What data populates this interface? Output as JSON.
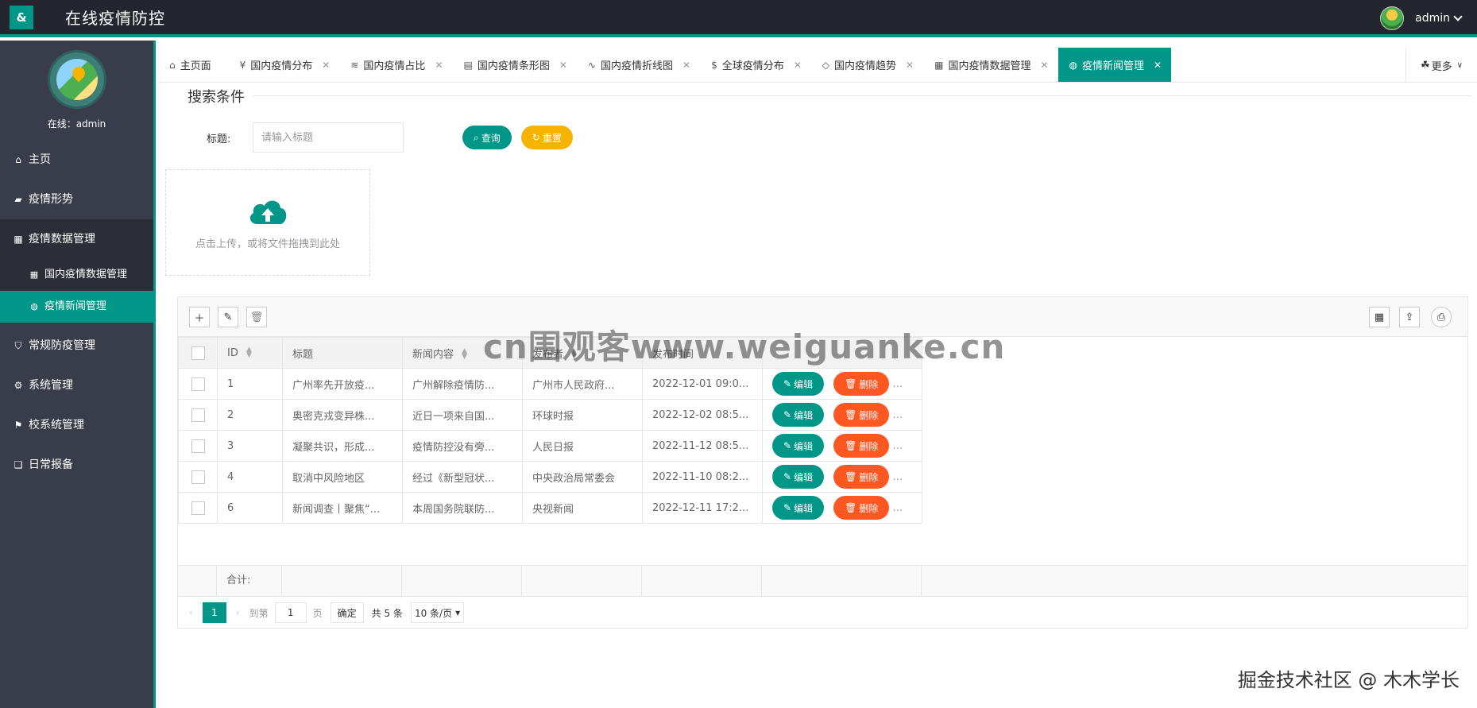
{
  "app": {
    "logo": "&",
    "title": "在线疫情防控",
    "user": "admin"
  },
  "sidebar": {
    "online": "在线：admin",
    "items": [
      {
        "label": "主页",
        "icon": "home-icon"
      },
      {
        "label": "疫情形势",
        "icon": "chart-icon"
      },
      {
        "label": "疫情数据管理",
        "icon": "grid-icon"
      },
      {
        "label": "常规防疫管理",
        "icon": "shield-icon"
      },
      {
        "label": "系统管理",
        "icon": "gear-icon"
      },
      {
        "label": "校系统管理",
        "icon": "flag-icon"
      },
      {
        "label": "日常报备",
        "icon": "book-icon"
      }
    ],
    "sub_items": [
      {
        "label": "国内疫情数据管理",
        "icon": "grid-icon"
      },
      {
        "label": "疫情新闻管理",
        "icon": "globe-icon"
      }
    ]
  },
  "tabs": [
    {
      "label": "主页面",
      "icon": "home-icon"
    },
    {
      "label": "国内疫情分布",
      "icon": "yen-icon"
    },
    {
      "label": "国内疫情占比",
      "icon": "layers-icon"
    },
    {
      "label": "国内疫情条形图",
      "icon": "bar-icon"
    },
    {
      "label": "国内疫情折线图",
      "icon": "pulse-icon"
    },
    {
      "label": "全球疫情分布",
      "icon": "dollar-icon"
    },
    {
      "label": "国内疫情趋势",
      "icon": "diamond-icon"
    },
    {
      "label": "国内疫情数据管理",
      "icon": "table-icon"
    },
    {
      "label": "疫情新闻管理",
      "icon": "globe-icon"
    }
  ],
  "more_label": "更多",
  "search": {
    "legend": "搜索条件",
    "title_label": "标题:",
    "title_placeholder": "请输入标题",
    "search_label": "查询",
    "reset_label": "重置"
  },
  "upload": {
    "text": "点击上传，或将文件拖拽到此处"
  },
  "table": {
    "headers": {
      "id": "ID",
      "title": "标题",
      "content": "新闻内容",
      "publisher": "发布者",
      "time": "发布时间"
    },
    "edit_label": "编辑",
    "delete_label": "删除",
    "rows": [
      {
        "id": "1",
        "title": "广州率先开放疫...",
        "content": "广州解除疫情防...",
        "publisher": "广州市人民政府...",
        "time": "2022-12-01 09:0..."
      },
      {
        "id": "2",
        "title": "奥密克戎变异株...",
        "content": "近日一项来自国...",
        "publisher": "环球时报",
        "time": "2022-12-02 08:5..."
      },
      {
        "id": "3",
        "title": "凝聚共识，形成...",
        "content": "疫情防控没有旁...",
        "publisher": "人民日报",
        "time": "2022-11-12 08:5..."
      },
      {
        "id": "4",
        "title": "取消中风险地区",
        "content": "经过《新型冠状...",
        "publisher": "中央政治局常委会",
        "time": "2022-11-10 08:2..."
      },
      {
        "id": "6",
        "title": "新闻调查丨聚焦“...",
        "content": "本周国务院联防...",
        "publisher": "央视新闻",
        "time": "2022-12-11 17:2..."
      }
    ],
    "total_label": "合计:"
  },
  "pager": {
    "current": "1",
    "goto_label": "到第",
    "goto_value": "1",
    "page_label": "页",
    "confirm_label": "确定",
    "total_label": "共 5 条",
    "page_size": "10 条/页"
  },
  "watermark": "cn围观客www.weiguanke.cn",
  "credit": "掘金技术社区 @ 木木学长",
  "colors": {
    "primary": "#009688",
    "warning": "#f6b300",
    "danger": "#ff5722",
    "header": "#23262e",
    "sidebar": "#393d49"
  }
}
